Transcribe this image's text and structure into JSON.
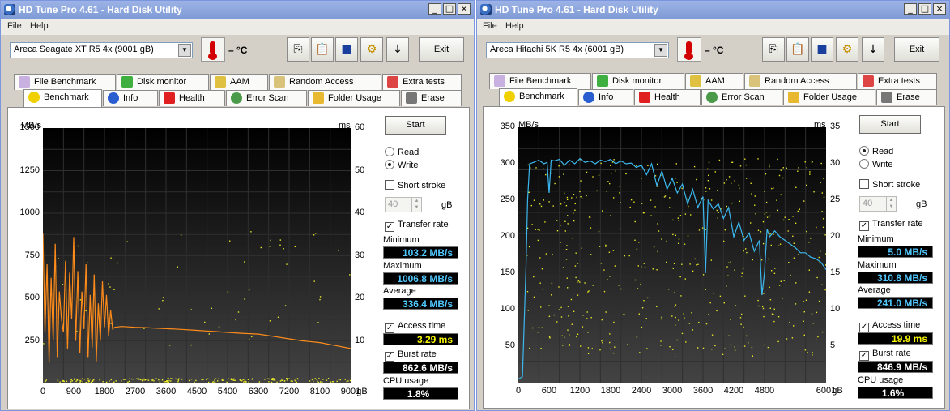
{
  "windows": [
    {
      "title": "HD Tune Pro 4.61 - Hard Disk Utility",
      "menu": [
        "File",
        "Help"
      ],
      "drive": "Areca   Seagate XT R5 4x (9001 gB)",
      "temperature": "– °C",
      "exit_label": "Exit",
      "tabs_row1": [
        "File Benchmark",
        "Disk monitor",
        "AAM",
        "Random Access",
        "Extra tests"
      ],
      "tabs_row2": [
        "Benchmark",
        "Info",
        "Health",
        "Error Scan",
        "Folder Usage",
        "Erase"
      ],
      "active_tab": "Benchmark",
      "start_label": "Start",
      "read_label": "Read",
      "write_label": "Write",
      "selected_mode": "Write",
      "short_stroke_label": "Short stroke",
      "short_stroke_value": "40",
      "short_stroke_unit": "gB",
      "transfer_rate_label": "Transfer rate",
      "stats": {
        "minimum_label": "Minimum",
        "minimum": "103.2 MB/s",
        "maximum_label": "Maximum",
        "maximum": "1006.8 MB/s",
        "average_label": "Average",
        "average": "336.4 MB/s",
        "access_time_label": "Access time",
        "access_time": "3.29 ms",
        "burst_rate_label": "Burst rate",
        "burst_rate": "862.6 MB/s",
        "cpu_usage_label": "CPU usage",
        "cpu_usage": "1.8%"
      },
      "chart_data": {
        "type": "line",
        "left_unit": "MB/s",
        "right_unit": "ms",
        "x_unit": "gB",
        "left_ticks": [
          "1500",
          "1250",
          "1000",
          "750",
          "500",
          "250"
        ],
        "right_ticks": [
          "60",
          "50",
          "40",
          "30",
          "20",
          "10"
        ],
        "x_ticks": [
          "0",
          "900",
          "1800",
          "2700",
          "3600",
          "4500",
          "5400",
          "6300",
          "7200",
          "8100",
          "9001"
        ],
        "xlim": [
          0,
          9001
        ],
        "ylim_left": [
          0,
          1500
        ],
        "ylim_right": [
          0,
          60
        ],
        "line_color": "#ff8c1a",
        "series": [
          {
            "x": [
              0,
              60,
              120,
              180,
              240,
              300,
              360,
              420,
              480,
              540,
              600,
              660,
              720,
              780,
              840,
              900,
              960,
              1020,
              1080,
              1140,
              1200,
              1260,
              1320,
              1380,
              1440,
              1500,
              1560,
              1620,
              1680,
              1740,
              1800,
              1860,
              1920,
              1980,
              2040,
              2100,
              2300,
              2700,
              3000,
              3300,
              3600,
              4000,
              4500,
              5000,
              5400,
              5800,
              6300,
              6800,
              7200,
              7600,
              8100,
              8500,
              9001
            ],
            "y": [
              880,
              300,
              700,
              120,
              620,
              250,
              820,
              150,
              540,
              380,
              300,
              720,
              200,
              650,
              380,
              860,
              250,
              660,
              180,
              540,
              320,
              700,
              150,
              520,
              210,
              640,
              130,
              470,
              250,
              600,
              330,
              520,
              280,
              430,
              320,
              330,
              335,
              330,
              328,
              325,
              322,
              318,
              312,
              305,
              300,
              295,
              290,
              275,
              262,
              250,
              240,
              225,
              205
            ]
          }
        ]
      }
    },
    {
      "title": "HD Tune Pro 4.61 - Hard Disk Utility",
      "menu": [
        "File",
        "Help"
      ],
      "drive": "Areca   Hitachi 5K R5 4x (6001 gB)",
      "temperature": "– °C",
      "exit_label": "Exit",
      "tabs_row1": [
        "File Benchmark",
        "Disk monitor",
        "AAM",
        "Random Access",
        "Extra tests"
      ],
      "tabs_row2": [
        "Benchmark",
        "Info",
        "Health",
        "Error Scan",
        "Folder Usage",
        "Erase"
      ],
      "active_tab": "Benchmark",
      "start_label": "Start",
      "read_label": "Read",
      "write_label": "Write",
      "selected_mode": "Read",
      "short_stroke_label": "Short stroke",
      "short_stroke_value": "40",
      "short_stroke_unit": "gB",
      "transfer_rate_label": "Transfer rate",
      "stats": {
        "minimum_label": "Minimum",
        "minimum": "5.0 MB/s",
        "maximum_label": "Maximum",
        "maximum": "310.8 MB/s",
        "average_label": "Average",
        "average": "241.0 MB/s",
        "access_time_label": "Access time",
        "access_time": "19.9 ms",
        "burst_rate_label": "Burst rate",
        "burst_rate": "846.9 MB/s",
        "cpu_usage_label": "CPU usage",
        "cpu_usage": "1.6%"
      },
      "chart_data": {
        "type": "line",
        "left_unit": "MB/s",
        "right_unit": "ms",
        "x_unit": "gB",
        "left_ticks": [
          "350",
          "300",
          "250",
          "200",
          "150",
          "100",
          "50"
        ],
        "right_ticks": [
          "35",
          "30",
          "25",
          "20",
          "15",
          "10",
          "5"
        ],
        "x_ticks": [
          "0",
          "600",
          "1200",
          "1800",
          "2400",
          "3000",
          "3600",
          "4200",
          "4800",
          "6001"
        ],
        "xlim": [
          0,
          6001
        ],
        "ylim_left": [
          0,
          350
        ],
        "ylim_right": [
          0,
          35
        ],
        "line_color": "#3cb8f0",
        "series": [
          {
            "x": [
              0,
              80,
              150,
              180,
              220,
              300,
              400,
              500,
              560,
              600,
              640,
              700,
              800,
              900,
              1000,
              1100,
              1200,
              1300,
              1400,
              1500,
              1600,
              1700,
              1800,
              1900,
              2000,
              2100,
              2200,
              2300,
              2400,
              2500,
              2600,
              2700,
              2800,
              2900,
              3000,
              3100,
              3200,
              3300,
              3400,
              3500,
              3600,
              3650,
              3700,
              3800,
              3900,
              4000,
              4100,
              4200,
              4300,
              4400,
              4500,
              4600,
              4700,
              4750,
              4800,
              4850,
              4900,
              5000,
              5100,
              5200,
              5300,
              5400,
              5500,
              5600,
              5700,
              5800,
              5900,
              6001
            ],
            "y": [
              5,
              8,
              160,
              250,
              300,
              302,
              305,
              300,
              302,
              260,
              305,
              304,
              306,
              298,
              305,
              300,
              307,
              302,
              304,
              300,
              305,
              303,
              306,
              300,
              304,
              300,
              301,
              295,
              298,
              285,
              300,
              270,
              290,
              265,
              280,
              260,
              272,
              245,
              265,
              240,
              255,
              150,
              250,
              238,
              245,
              225,
              240,
              200,
              220,
              195,
              205,
              180,
              195,
              120,
              150,
              210,
              200,
              208,
              200,
              195,
              190,
              185,
              178,
              178,
              172,
              170,
              165,
              155
            ]
          }
        ]
      }
    }
  ]
}
